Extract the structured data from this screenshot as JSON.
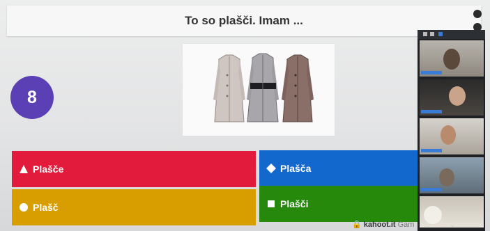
{
  "question": {
    "text": "To so plašči. Imam ..."
  },
  "timer": {
    "value": "8"
  },
  "image": {
    "icon": "coats-image-icon"
  },
  "answers": [
    {
      "label": "Plašče",
      "shape": "triangle",
      "color": "#e21b3c"
    },
    {
      "label": "Plašča",
      "shape": "diamond",
      "color": "#1368ce"
    },
    {
      "label": "Plašč",
      "shape": "circle",
      "color": "#d89e00"
    },
    {
      "label": "Plašči",
      "shape": "square",
      "color": "#26890c"
    }
  ],
  "footer": {
    "site": "kahoot.it",
    "game": "Gam"
  },
  "colors": {
    "timer": "#5a3fb5",
    "topbar": "#f7f7f7",
    "zoom_bg": "#1f2124"
  },
  "participants": [
    {
      "icon": "video-participant-1"
    },
    {
      "icon": "video-participant-2"
    },
    {
      "icon": "video-participant-3"
    },
    {
      "icon": "video-participant-4"
    },
    {
      "icon": "video-participant-5"
    }
  ]
}
